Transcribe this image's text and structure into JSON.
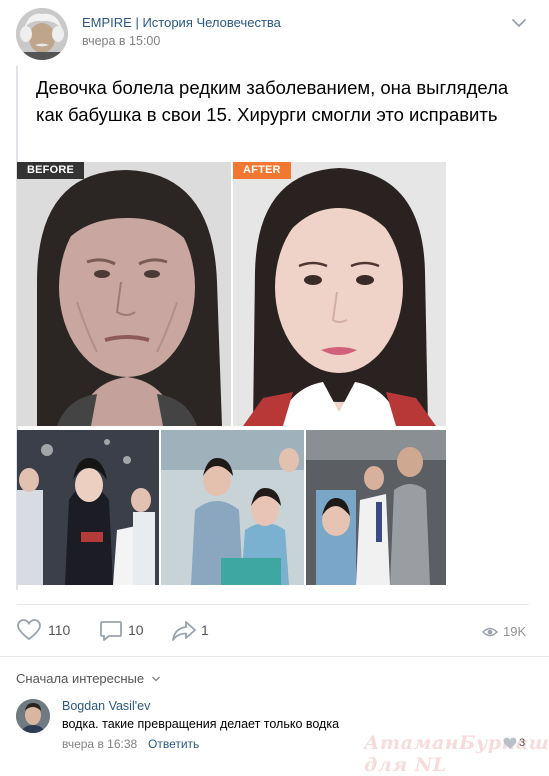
{
  "post": {
    "group_name": "EMPIRE | История Человечества",
    "time": "вчера в 15:00",
    "text": "Девочка болела редким заболеванием, она выглядела как бабушка в свои 15. Хирурги смогли это исправить",
    "badge_before": "BEFORE",
    "badge_after": "AFTER"
  },
  "actions": {
    "likes": "110",
    "comments": "10",
    "shares": "1",
    "views": "19K"
  },
  "comments": {
    "sort_label": "Сначала интересные",
    "items": [
      {
        "author": "Bogdan Vasil'ev",
        "text": "водка. такие превращения делает только водка",
        "time": "вчера в 16:38",
        "reply_label": "Ответить",
        "likes": "3"
      }
    ]
  },
  "watermark": "АтаманБурнаш для  NL",
  "colors": {
    "link": "#2a5885",
    "meta": "#828282",
    "after_badge": "#f07830",
    "icon": "#99a2ad"
  }
}
